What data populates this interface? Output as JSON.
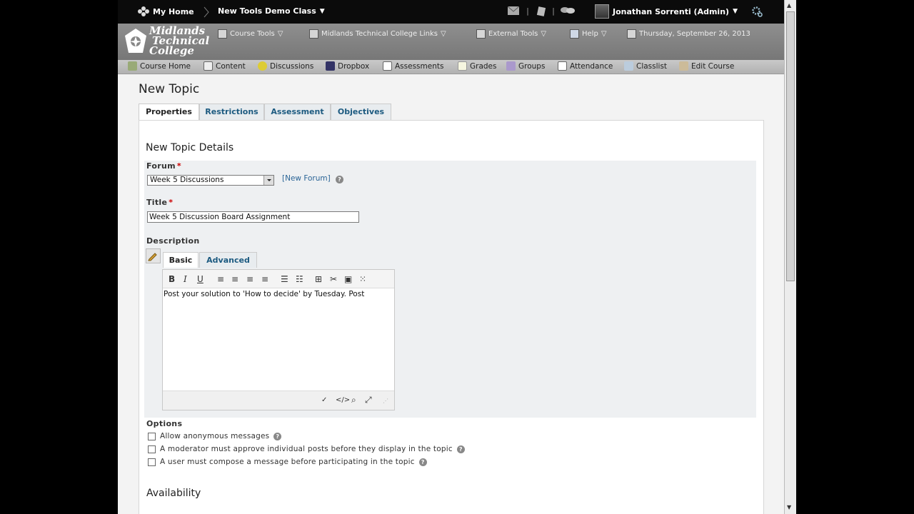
{
  "minibar": {
    "home_label": "My Home",
    "course_label": "New Tools Demo Class",
    "user_label": "Jonathan Sorrenti (Admin)"
  },
  "navbar": {
    "logo_line1": "Midlands",
    "logo_line2": "Technical",
    "logo_line3": "College",
    "links": [
      "Course Tools",
      "Midlands Technical College Links",
      "External Tools",
      "Help"
    ],
    "date": "Thursday, September 26, 2013"
  },
  "coursebar": {
    "items": [
      "Course Home",
      "Content",
      "Discussions",
      "Dropbox",
      "Assessments",
      "Grades",
      "Groups",
      "Attendance",
      "Classlist",
      "Edit Course"
    ]
  },
  "page": {
    "title": "New Topic",
    "tabs": [
      "Properties",
      "Restrictions",
      "Assessment",
      "Objectives"
    ]
  },
  "form": {
    "section_title": "New Topic Details",
    "forum_label": "Forum",
    "forum_value": "Week 5 Discussions",
    "new_forum_link": "[New Forum]",
    "title_label": "Title",
    "title_value": "Week 5 Discussion Board Assignment",
    "description_label": "Description",
    "editor_tabs": [
      "Basic",
      "Advanced"
    ],
    "editor_text": "Post your solution to 'How to decide' by Tuesday. Post",
    "options_label": "Options",
    "options": [
      "Allow anonymous messages",
      "A moderator must approve individual posts before they display in the topic",
      "A user must compose a message before participating in the topic"
    ],
    "availability_title": "Availability"
  },
  "colors": {
    "minibar_bg": "#0b0b0b",
    "navbar_bg": "#808080",
    "tab_link": "#1c5a80",
    "required": "#cc0000"
  }
}
